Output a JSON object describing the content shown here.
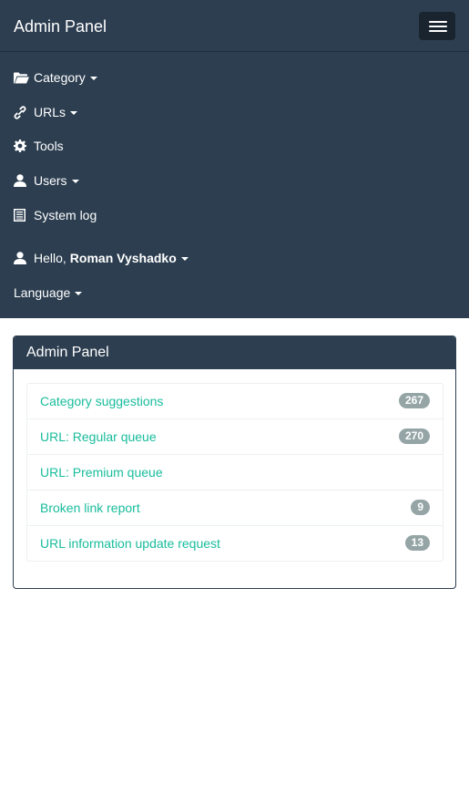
{
  "navbar": {
    "brand": "Admin Panel",
    "items": [
      {
        "label": "Category",
        "icon": "folder-open-icon",
        "dropdown": true
      },
      {
        "label": "URLs",
        "icon": "link-icon",
        "dropdown": true
      },
      {
        "label": "Tools",
        "icon": "cog-icon",
        "dropdown": false
      },
      {
        "label": "Users",
        "icon": "user-icon",
        "dropdown": true
      },
      {
        "label": "System log",
        "icon": "list-icon",
        "dropdown": false
      }
    ],
    "greeting": {
      "prefix": "Hello,",
      "name": "Roman Vyshadko",
      "icon": "user-icon"
    },
    "language": "Language",
    "colors": {
      "background": "#2c3e50",
      "text": "#ffffff"
    }
  },
  "panel": {
    "title": "Admin Panel",
    "items": [
      {
        "label": "Category suggestions",
        "count": "267"
      },
      {
        "label": "URL: Regular queue",
        "count": "270"
      },
      {
        "label": "URL: Premium queue",
        "count": ""
      },
      {
        "label": "Broken link report",
        "count": "9"
      },
      {
        "label": "URL information update request",
        "count": "13"
      }
    ],
    "colors": {
      "link": "#18bc9c",
      "badge": "#95a5a6"
    }
  }
}
